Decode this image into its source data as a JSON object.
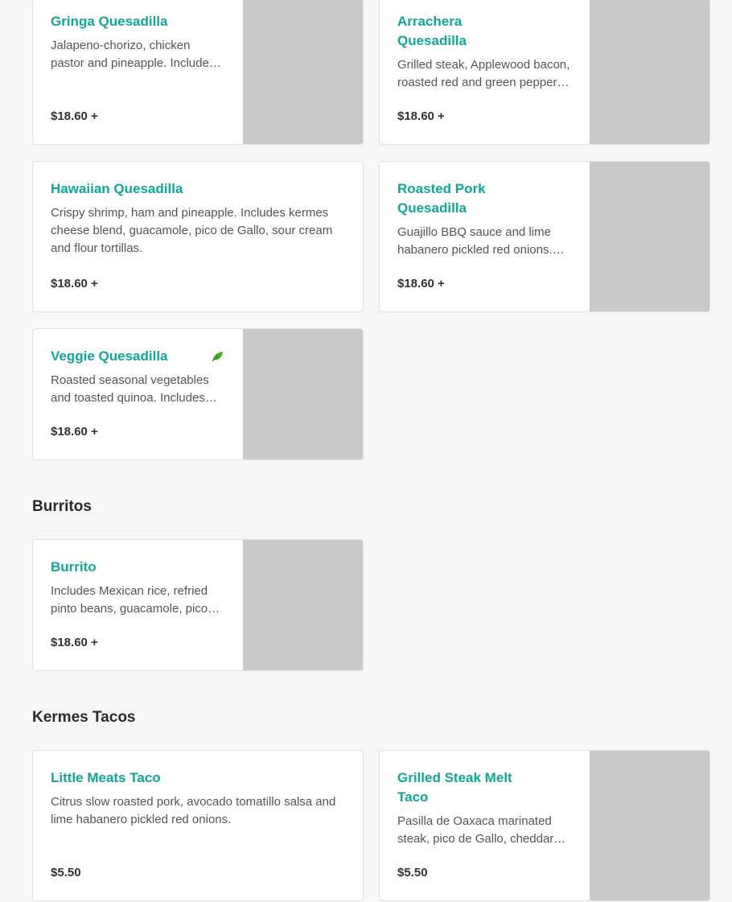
{
  "quesadillas": [
    {
      "name": "Gringa Quesadilla",
      "desc": "Jalapeno-chorizo, chicken pastor and pineapple. Includes kermes cheese blend, guacamole, pico de Gallo, sour cream and flour tortillas.",
      "price": "$18.60 +"
    },
    {
      "name": "Arrachera Quesadilla",
      "desc": "Grilled steak, Applewood bacon, roasted red and green peppers. Includes kermes cheese blend, guacamole, pico de Gallo, sour cream and flour tortillas.",
      "price": "$18.60 +"
    },
    {
      "name": "Hawaiian Quesadilla",
      "desc": "Crispy shrimp, ham and pineapple. Includes kermes cheese blend, guacamole, pico de Gallo, sour cream and flour tortillas.",
      "price": "$18.60 +"
    },
    {
      "name": "Roasted Pork Quesadilla",
      "desc": "Guajillo BBQ sauce and lime habanero pickled red onions. Includes kermes cheese blend, guacamole, pico de Gallo, sour cream and flour tortillas.",
      "price": "$18.60 +"
    },
    {
      "name": "Veggie Quesadilla",
      "desc": "Roasted seasonal vegetables and toasted quinoa. Includes kermes cheese blend, guacamole, pico de Gallo, sour cream and flour tortillas.",
      "price": "$18.60 +",
      "icon": "leaf-icon"
    }
  ],
  "burritos": {
    "title": "Burritos",
    "items": [
      {
        "name": "Burrito",
        "desc": "Includes Mexican rice, refried pinto beans, guacamole, pico de Gallo, sour cream and cheese.",
        "price": "$18.60 +"
      }
    ]
  },
  "tacos": {
    "title": "Kermes Tacos",
    "items": [
      {
        "name": "Little Meats Taco",
        "desc": "Citrus slow roasted pork, avocado tomatillo salsa and lime habanero pickled red onions.",
        "price": "$5.50"
      },
      {
        "name": "Grilled Steak Melt Taco",
        "desc": "Pasilla de Oaxaca marinated steak, pico de Gallo, cheddar cheese and chipotle salsa.",
        "price": "$5.50"
      }
    ]
  },
  "colors": {
    "accent": "#0ea79a",
    "leaf": "#3fae29",
    "image_placeholder": "#c8c9ca"
  }
}
